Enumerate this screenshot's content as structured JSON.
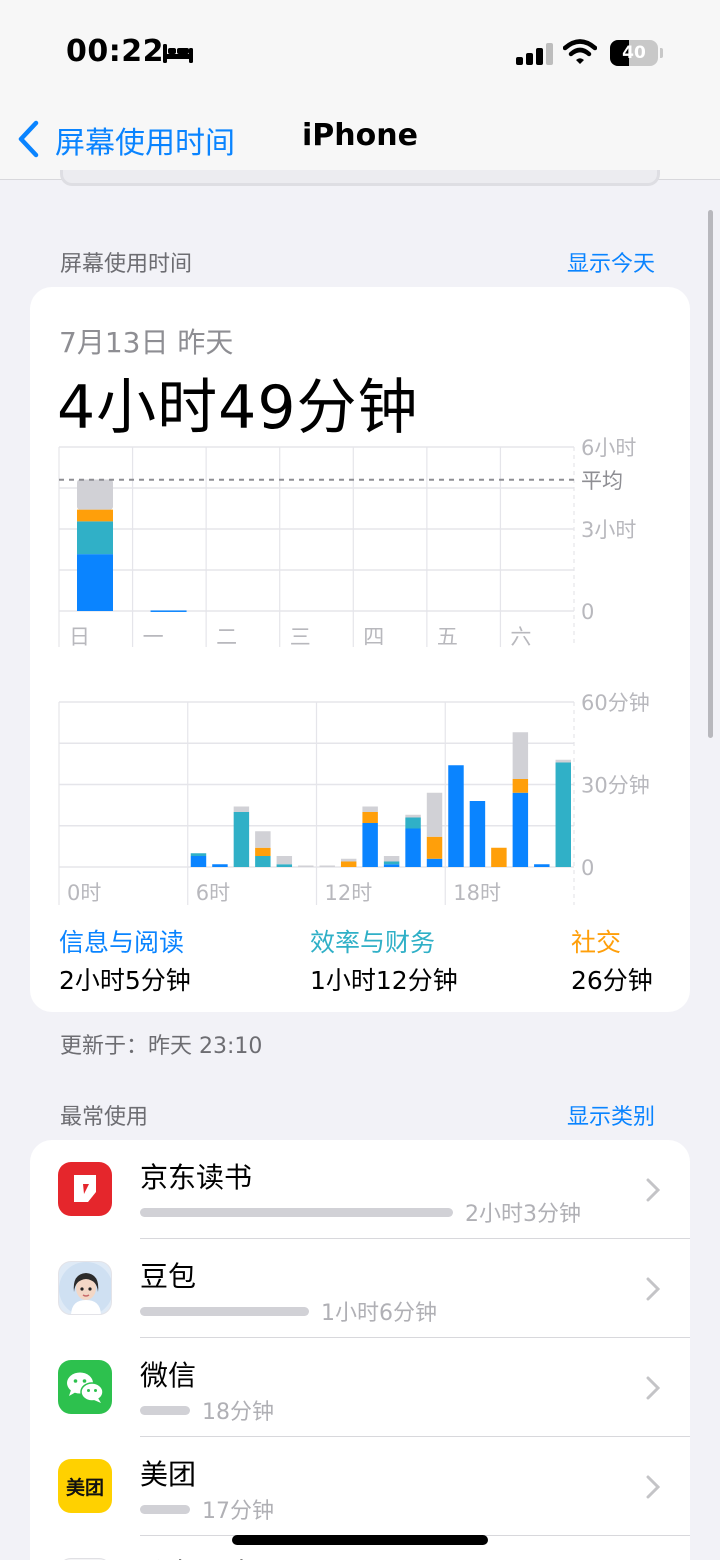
{
  "status_bar": {
    "time": "00:22",
    "battery_percent": "40",
    "battery_level": 0.4,
    "icons": [
      "bed-icon",
      "signal-icon",
      "wifi-icon",
      "battery-icon"
    ]
  },
  "nav": {
    "back_label": "屏幕使用时间",
    "title": "iPhone"
  },
  "screen_time_section": {
    "label": "屏幕使用时间",
    "link": "显示今天"
  },
  "summary": {
    "date": "7月13日 昨天",
    "total": "4小时49分钟"
  },
  "colors": {
    "info_reading": "#0a84ff",
    "productivity_finance": "#30b0c7",
    "social": "#ff9f0a",
    "other": "#d1d1d6",
    "accent": "#0a84ff"
  },
  "chart_data": [
    {
      "type": "bar",
      "stacked": true,
      "categories": [
        "日",
        "一",
        "二",
        "三",
        "四",
        "五",
        "六"
      ],
      "y_tick_labels": [
        "6小时",
        "3小时",
        "0"
      ],
      "ylim_hours": [
        0,
        6
      ],
      "average_label": "平均",
      "average_hours": 4.8,
      "series": [
        {
          "name": "信息与阅读",
          "values": [
            2.08,
            0.02,
            0,
            0,
            0,
            0,
            0
          ]
        },
        {
          "name": "效率与财务",
          "values": [
            1.2,
            0,
            0,
            0,
            0,
            0,
            0
          ]
        },
        {
          "name": "社交",
          "values": [
            0.43,
            0,
            0,
            0,
            0,
            0,
            0
          ]
        },
        {
          "values": [
            1.1,
            0,
            0,
            0,
            0,
            0,
            0
          ]
        }
      ]
    },
    {
      "type": "bar",
      "stacked": true,
      "x_tick_labels": [
        "0时",
        "6时",
        "12时",
        "18时"
      ],
      "y_tick_labels": [
        "60分钟",
        "30分钟",
        "0"
      ],
      "ylim_minutes": [
        0,
        60
      ],
      "hours": [
        0,
        1,
        2,
        3,
        4,
        5,
        6,
        7,
        8,
        9,
        10,
        11,
        12,
        13,
        14,
        15,
        16,
        17,
        18,
        19,
        20,
        21,
        22,
        23
      ],
      "series": [
        {
          "name": "信息与阅读",
          "values": [
            0,
            0,
            0,
            0,
            0,
            0,
            4,
            1,
            0,
            0,
            0,
            0,
            0,
            0,
            16,
            1,
            14,
            3,
            37,
            24,
            0,
            27,
            1,
            0
          ]
        },
        {
          "name": "效率与财务",
          "values": [
            0,
            0,
            0,
            0,
            0,
            0,
            1,
            0,
            20,
            4,
            1,
            0,
            0,
            0,
            0,
            1,
            4,
            0,
            0,
            0,
            0,
            0,
            0,
            38
          ]
        },
        {
          "name": "社交",
          "values": [
            0,
            0,
            0,
            0,
            0,
            0,
            0,
            0,
            0,
            3,
            0,
            0,
            0,
            2,
            4,
            0,
            0,
            8,
            0,
            0,
            7,
            5,
            0,
            0
          ]
        },
        {
          "values": [
            0,
            0,
            0,
            0,
            0,
            0,
            0,
            0,
            2,
            6,
            3,
            0,
            0,
            1,
            2,
            2,
            1,
            16,
            0,
            0,
            0,
            17,
            0,
            1
          ]
        }
      ]
    }
  ],
  "categories": [
    {
      "name": "信息与阅读",
      "value": "2小时5分钟",
      "color": "#0a84ff"
    },
    {
      "name": "效率与财务",
      "value": "1小时12分钟",
      "color": "#30b0c7"
    },
    {
      "name": "社交",
      "value": "26分钟",
      "color": "#ff9f0a"
    }
  ],
  "updated": "更新于：昨天 23:10",
  "most_used_section": {
    "label": "最常使用",
    "link": "显示类别"
  },
  "apps": [
    {
      "name": "京东读书",
      "usage": "2小时3分钟",
      "fraction": 1.0,
      "icon": "jd-read-icon"
    },
    {
      "name": "豆包",
      "usage": "1小时6分钟",
      "fraction": 0.54,
      "icon": "doubao-icon"
    },
    {
      "name": "微信",
      "usage": "18分钟",
      "fraction": 0.15,
      "icon": "wechat-icon"
    },
    {
      "name": "美团",
      "usage": "17分钟",
      "fraction": 0.14,
      "icon_text": "美团",
      "icon": "meituan-icon"
    },
    {
      "name": "分老雷达"
    }
  ]
}
